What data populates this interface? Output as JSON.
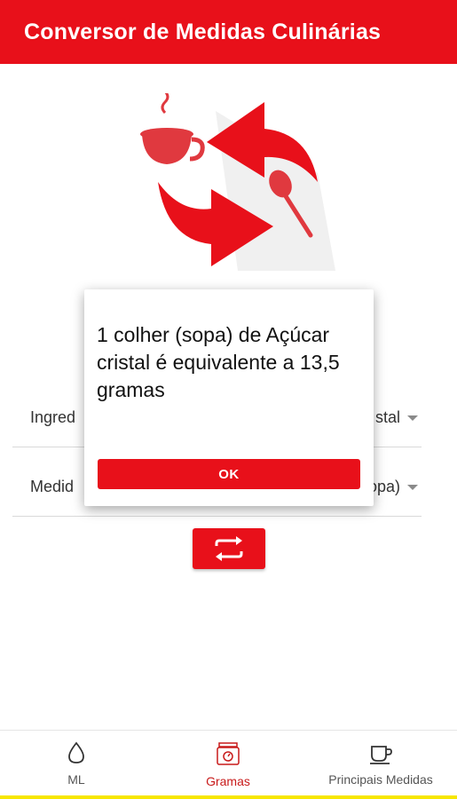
{
  "appbar": {
    "title": "Conversor de Medidas Culinárias"
  },
  "form": {
    "ingredient_label": "Ingred",
    "ingredient_value": "stal",
    "measure_label": "Medid",
    "measure_value": "opa)"
  },
  "dialog": {
    "message": "1 colher (sopa) de Açúcar cristal é equivalente a 13,5 gramas",
    "ok_label": "OK"
  },
  "bottom_nav": {
    "items": [
      {
        "label": "ML",
        "icon": "drop-icon",
        "active": false
      },
      {
        "label": "Gramas",
        "icon": "scale-icon",
        "active": true
      },
      {
        "label": "Principais Medidas",
        "icon": "cup-icon",
        "active": false
      }
    ]
  },
  "colors": {
    "primary": "#e8101a",
    "active_nav": "#c81a1a",
    "inactive_nav": "#555555",
    "accent_bottom": "#f7e600"
  }
}
